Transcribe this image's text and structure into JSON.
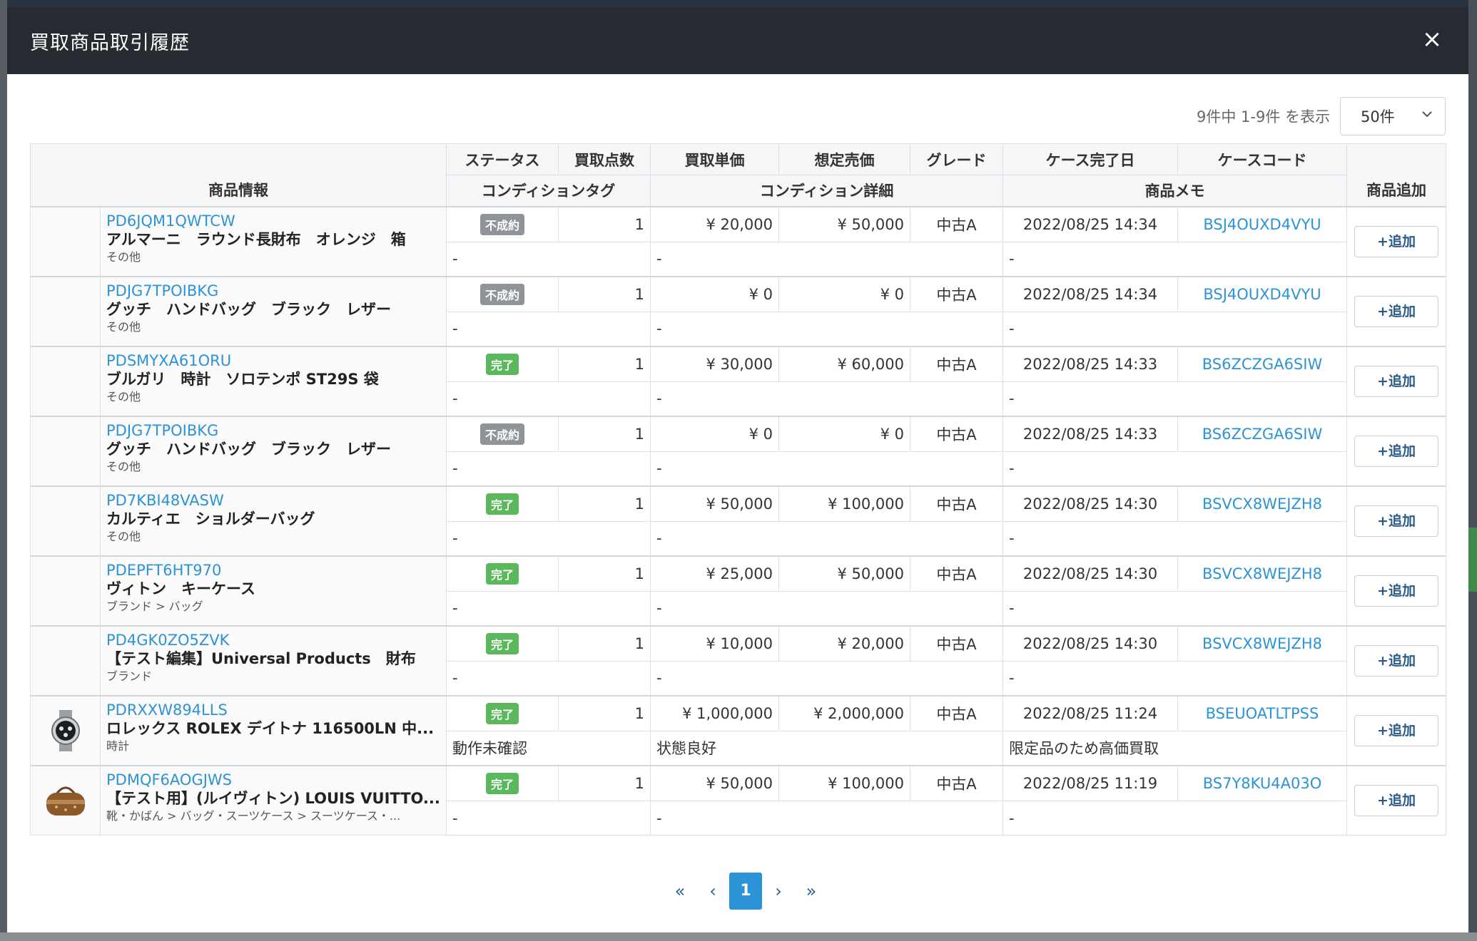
{
  "modal": {
    "title": "買取商品取引履歴",
    "close_label": "×"
  },
  "toolbar": {
    "count_text": "9件中 1-9件 を表示",
    "per_page": "50件"
  },
  "table": {
    "headers": {
      "product_info": "商品情報",
      "status": "ステータス",
      "qty": "買取点数",
      "unit_price": "買取単価",
      "expected_price": "想定売価",
      "grade": "グレード",
      "case_done": "ケース完了日",
      "case_code": "ケースコード",
      "condition_tag": "コンディションタグ",
      "condition_detail": "コンディション詳細",
      "memo": "商品メモ",
      "add_product": "商品追加"
    },
    "rows": [
      {
        "code": "PD6JQM1QWTCW",
        "name": "アルマーニ　ラウンド長財布　オレンジ　箱",
        "category": "その他",
        "status": "不成約",
        "qty": "1",
        "unit_price": "¥ 20,000",
        "expected_price": "¥ 50,000",
        "grade": "中古A",
        "case_done": "2022/08/25 14:34",
        "case_code": "BSJ4OUXD4VYU",
        "cond_tag": "-",
        "cond_detail": "-",
        "memo": "-",
        "add": "+追加"
      },
      {
        "code": "PDJG7TPOIBKG",
        "name": "グッチ　ハンドバッグ　ブラック　レザー",
        "category": "その他",
        "status": "不成約",
        "qty": "1",
        "unit_price": "¥ 0",
        "expected_price": "¥ 0",
        "grade": "中古A",
        "case_done": "2022/08/25 14:34",
        "case_code": "BSJ4OUXD4VYU",
        "cond_tag": "-",
        "cond_detail": "-",
        "memo": "-",
        "add": "+追加"
      },
      {
        "code": "PDSMYXA61ORU",
        "name": "ブルガリ　時計　ソロテンポ ST29S 袋",
        "category": "その他",
        "status": "完了",
        "qty": "1",
        "unit_price": "¥ 30,000",
        "expected_price": "¥ 60,000",
        "grade": "中古A",
        "case_done": "2022/08/25 14:33",
        "case_code": "BS6ZCZGA6SIW",
        "cond_tag": "-",
        "cond_detail": "-",
        "memo": "-",
        "add": "+追加"
      },
      {
        "code": "PDJG7TPOIBKG",
        "name": "グッチ　ハンドバッグ　ブラック　レザー",
        "category": "その他",
        "status": "不成約",
        "qty": "1",
        "unit_price": "¥ 0",
        "expected_price": "¥ 0",
        "grade": "中古A",
        "case_done": "2022/08/25 14:33",
        "case_code": "BS6ZCZGA6SIW",
        "cond_tag": "-",
        "cond_detail": "-",
        "memo": "-",
        "add": "+追加"
      },
      {
        "code": "PD7KBI48VASW",
        "name": "カルティエ　ショルダーバッグ",
        "category": "その他",
        "status": "完了",
        "qty": "1",
        "unit_price": "¥ 50,000",
        "expected_price": "¥ 100,000",
        "grade": "中古A",
        "case_done": "2022/08/25 14:30",
        "case_code": "BSVCX8WEJZH8",
        "cond_tag": "-",
        "cond_detail": "-",
        "memo": "-",
        "add": "+追加"
      },
      {
        "code": "PDEPFT6HT970",
        "name": "ヴィトン　キーケース",
        "category": "ブランド > バッグ",
        "status": "完了",
        "qty": "1",
        "unit_price": "¥ 25,000",
        "expected_price": "¥ 50,000",
        "grade": "中古A",
        "case_done": "2022/08/25 14:30",
        "case_code": "BSVCX8WEJZH8",
        "cond_tag": "-",
        "cond_detail": "-",
        "memo": "-",
        "add": "+追加"
      },
      {
        "code": "PD4GK0ZO5ZVK",
        "name": "【テスト編集】Universal Products　財布",
        "category": "ブランド",
        "status": "完了",
        "qty": "1",
        "unit_price": "¥ 10,000",
        "expected_price": "¥ 20,000",
        "grade": "中古A",
        "case_done": "2022/08/25 14:30",
        "case_code": "BSVCX8WEJZH8",
        "cond_tag": "-",
        "cond_detail": "-",
        "memo": "-",
        "add": "+追加"
      },
      {
        "code": "PDRXXW894LLS",
        "name": "ロレックス ROLEX デイトナ 116500LN 中...",
        "category": "時計",
        "status": "完了",
        "qty": "1",
        "unit_price": "¥ 1,000,000",
        "expected_price": "¥ 2,000,000",
        "grade": "中古A",
        "case_done": "2022/08/25 11:24",
        "case_code": "BSEUOATLTPSS",
        "cond_tag": "動作未確認",
        "cond_detail": "状態良好",
        "memo": "限定品のため高価買取",
        "add": "+追加",
        "image": "watch"
      },
      {
        "code": "PDMQF6AOGJWS",
        "name": "【テスト用】(ルイヴィトン) LOUIS VUITTO...",
        "category": "靴・かばん > バッグ・スーツケース > スーツケース・...",
        "status": "完了",
        "qty": "1",
        "unit_price": "¥ 50,000",
        "expected_price": "¥ 100,000",
        "grade": "中古A",
        "case_done": "2022/08/25 11:19",
        "case_code": "BS7Y8KU4A03O",
        "cond_tag": "-",
        "cond_detail": "-",
        "memo": "-",
        "add": "+追加",
        "image": "bag"
      }
    ]
  },
  "pagination": {
    "first": "«",
    "prev": "‹",
    "current": "1",
    "next": "›",
    "last": "»"
  },
  "colors": {
    "link": "#2b93d6",
    "badge_done": "#5cb85c",
    "badge_ng": "#8e9499",
    "header_dark": "#252b31"
  }
}
